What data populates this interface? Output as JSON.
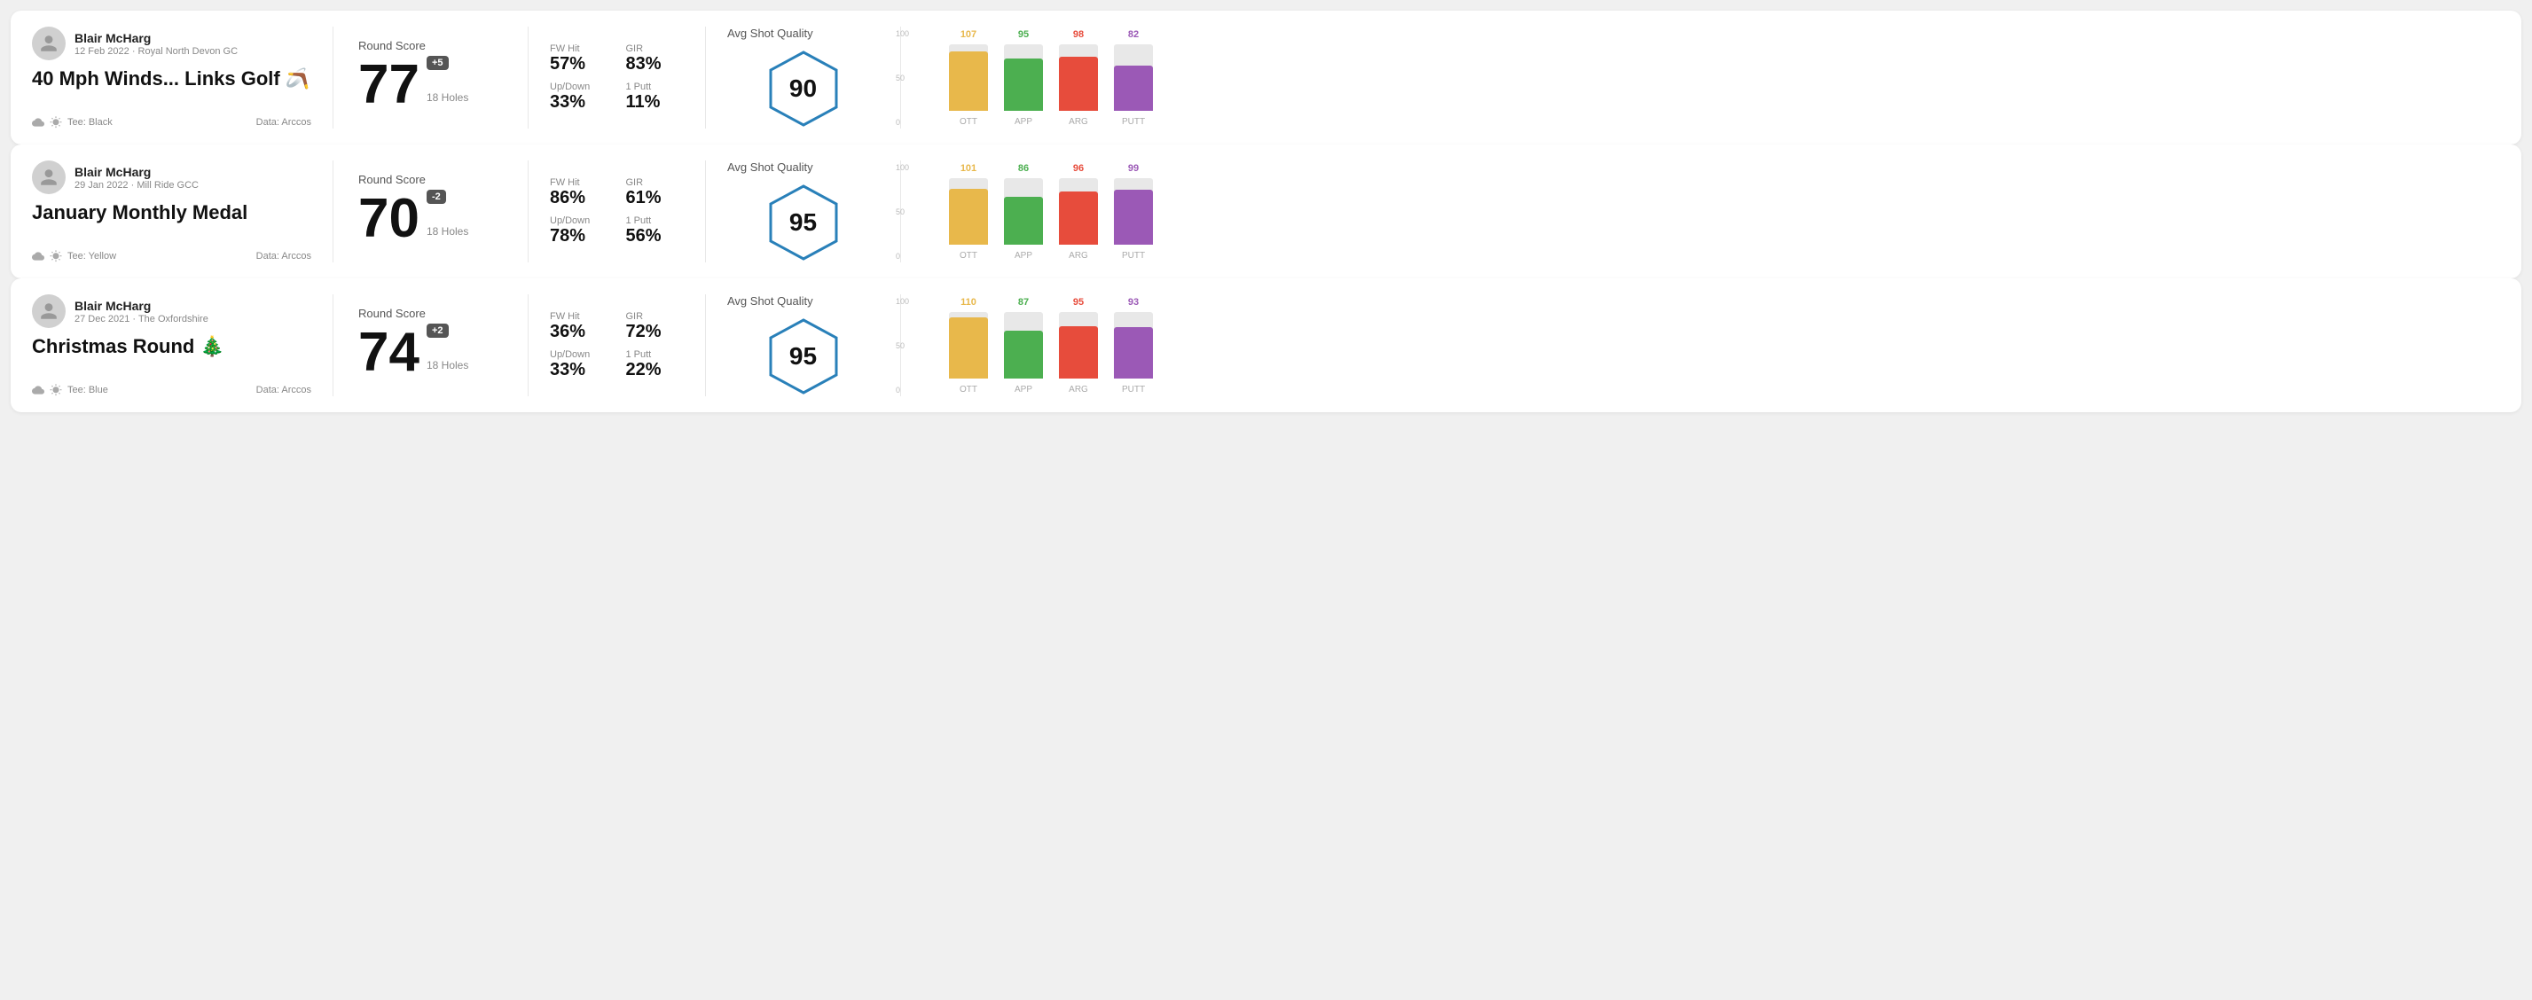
{
  "rounds": [
    {
      "id": "round1",
      "user_name": "Blair McHarg",
      "user_date": "12 Feb 2022 · Royal North Devon GC",
      "round_title": "40 Mph Winds... Links Golf 🪃",
      "tee": "Black",
      "data_source": "Data: Arccos",
      "round_score_label": "Round Score",
      "score": "77",
      "score_diff": "+5",
      "holes": "18 Holes",
      "fw_hit_label": "FW Hit",
      "fw_hit_value": "57%",
      "gir_label": "GIR",
      "gir_value": "83%",
      "updown_label": "Up/Down",
      "updown_value": "33%",
      "one_putt_label": "1 Putt",
      "one_putt_value": "11%",
      "avg_shot_quality_label": "Avg Shot Quality",
      "quality_score": "90",
      "chart": {
        "bars": [
          {
            "label": "OTT",
            "value": 107,
            "color": "#e8b84b",
            "max": 120
          },
          {
            "label": "APP",
            "value": 95,
            "color": "#4caf50",
            "max": 120
          },
          {
            "label": "ARG",
            "value": 98,
            "color": "#e74c3c",
            "max": 120
          },
          {
            "label": "PUTT",
            "value": 82,
            "color": "#9b59b6",
            "max": 120
          }
        ]
      }
    },
    {
      "id": "round2",
      "user_name": "Blair McHarg",
      "user_date": "29 Jan 2022 · Mill Ride GCC",
      "round_title": "January Monthly Medal",
      "tee": "Yellow",
      "data_source": "Data: Arccos",
      "round_score_label": "Round Score",
      "score": "70",
      "score_diff": "-2",
      "holes": "18 Holes",
      "fw_hit_label": "FW Hit",
      "fw_hit_value": "86%",
      "gir_label": "GIR",
      "gir_value": "61%",
      "updown_label": "Up/Down",
      "updown_value": "78%",
      "one_putt_label": "1 Putt",
      "one_putt_value": "56%",
      "avg_shot_quality_label": "Avg Shot Quality",
      "quality_score": "95",
      "chart": {
        "bars": [
          {
            "label": "OTT",
            "value": 101,
            "color": "#e8b84b",
            "max": 120
          },
          {
            "label": "APP",
            "value": 86,
            "color": "#4caf50",
            "max": 120
          },
          {
            "label": "ARG",
            "value": 96,
            "color": "#e74c3c",
            "max": 120
          },
          {
            "label": "PUTT",
            "value": 99,
            "color": "#9b59b6",
            "max": 120
          }
        ]
      }
    },
    {
      "id": "round3",
      "user_name": "Blair McHarg",
      "user_date": "27 Dec 2021 · The Oxfordshire",
      "round_title": "Christmas Round 🎄",
      "tee": "Blue",
      "data_source": "Data: Arccos",
      "round_score_label": "Round Score",
      "score": "74",
      "score_diff": "+2",
      "holes": "18 Holes",
      "fw_hit_label": "FW Hit",
      "fw_hit_value": "36%",
      "gir_label": "GIR",
      "gir_value": "72%",
      "updown_label": "Up/Down",
      "updown_value": "33%",
      "one_putt_label": "1 Putt",
      "one_putt_value": "22%",
      "avg_shot_quality_label": "Avg Shot Quality",
      "quality_score": "95",
      "chart": {
        "bars": [
          {
            "label": "OTT",
            "value": 110,
            "color": "#e8b84b",
            "max": 120
          },
          {
            "label": "APP",
            "value": 87,
            "color": "#4caf50",
            "max": 120
          },
          {
            "label": "ARG",
            "value": 95,
            "color": "#e74c3c",
            "max": 120
          },
          {
            "label": "PUTT",
            "value": 93,
            "color": "#9b59b6",
            "max": 120
          }
        ]
      }
    }
  ]
}
